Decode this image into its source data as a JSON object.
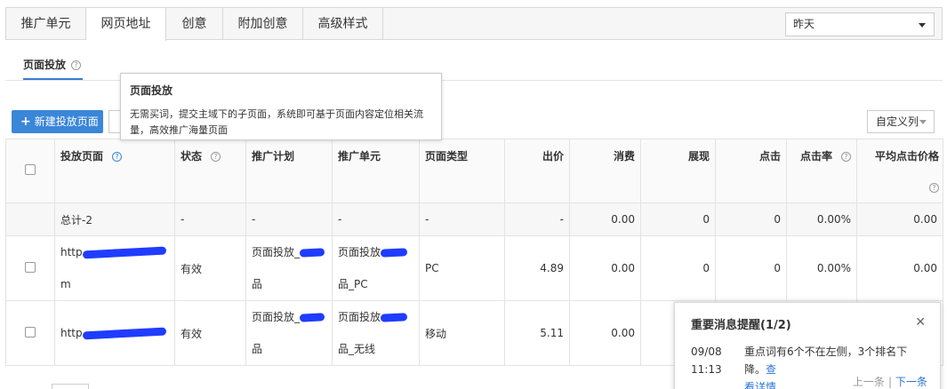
{
  "tabs": [
    {
      "label": "推广单元"
    },
    {
      "label": "网页地址",
      "active": true
    },
    {
      "label": "创意"
    },
    {
      "label": "附加创意"
    },
    {
      "label": "高级样式"
    }
  ],
  "date_select": {
    "value": "昨天"
  },
  "subtab": {
    "label": "页面投放"
  },
  "tooltip": {
    "title": "页面投放",
    "body_line1": "无需买词，提交主域下的子页面，系统即可基于页面内容定位相关流",
    "body_line2": "量，高效推广海量页面"
  },
  "toolbar": {
    "new_button": "新建投放页面",
    "custom_columns": "自定义列"
  },
  "table": {
    "headers": [
      "投放页面",
      "状态",
      "推广计划",
      "推广单元",
      "页面类型",
      "出价",
      "消费",
      "展现",
      "点击",
      "点击率",
      "平均点击价格"
    ],
    "total_row": [
      "总计-2",
      "-",
      "-",
      "-",
      "-",
      "-",
      "0.00",
      "0",
      "0",
      "0.00%",
      "0.00"
    ],
    "rows": [
      {
        "page_a": "http",
        "page_b": "m",
        "status": "有效",
        "plan_a": "页面投放_",
        "plan_b": "品",
        "unit_a": "页面投放",
        "unit_b": "品_PC",
        "type": "PC",
        "bid": "4.89",
        "cost": "0.00",
        "impr": "0",
        "clicks": "0",
        "ctr": "0.00%",
        "cpc": "0.00"
      },
      {
        "page_a": "http",
        "page_b": "",
        "status": "有效",
        "plan_a": "页面投放_",
        "plan_b": "品",
        "unit_a": "页面投放",
        "unit_b": "品_无线",
        "type": "移动",
        "bid": "5.11",
        "cost": "0.00",
        "impr": "",
        "clicks": "",
        "ctr": "",
        "cpc": ""
      }
    ]
  },
  "message": {
    "title": "重要消息提醒(1/2)",
    "date": "09/08",
    "time": "11:13",
    "text": "重点词有6个不在左侧，3个排名下降。",
    "text_link": "查",
    "detail_link": "看详情",
    "prev": "上一条",
    "next": "下一条"
  }
}
